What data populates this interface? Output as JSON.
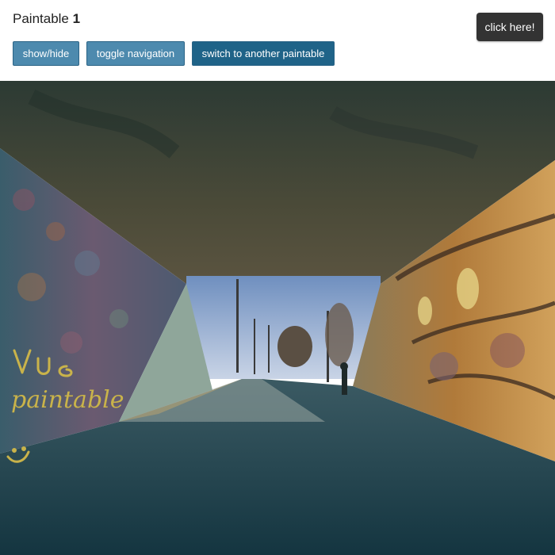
{
  "app": {
    "title_prefix": "Paintable",
    "title_number": "1"
  },
  "toolbar": {
    "show_hide_label": "show/hide",
    "toggle_nav_label": "toggle navigation",
    "switch_label": "switch to another paintable"
  },
  "cta": {
    "click_label": "click here!"
  },
  "colors": {
    "button_light": "#4d8aae",
    "button_dark": "#1f6388",
    "cta_bg": "#333333",
    "ink": "#c9b34a"
  },
  "canvas": {
    "handwriting_line_1": "vue",
    "handwriting_line_2": "paintable",
    "smiley_icon": "smiley-face-icon"
  }
}
